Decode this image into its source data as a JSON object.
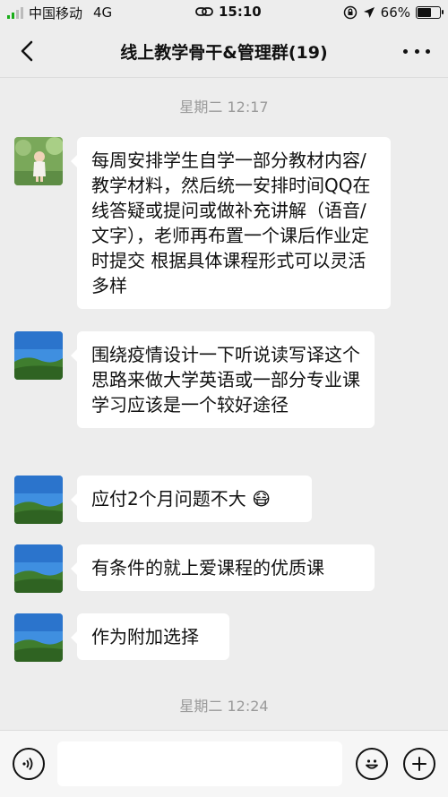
{
  "status_bar": {
    "carrier": "中国移动",
    "network": "4G",
    "time": "15:10",
    "battery": "66%",
    "battery_level": 0.66
  },
  "header": {
    "title": "线上教学骨干&管理群(19)"
  },
  "timestamps": [
    "星期二 12:17",
    "星期二 12:24"
  ],
  "messages": [
    {
      "text": "每周安排学生自学一部分教材内容/教学材料，然后统一安排时间QQ在线答疑或提问或做补充讲解（语音/文字），老师再布置一个课后作业定时提交 根据具体课程形式可以灵活多样"
    },
    {
      "text": "围绕疫情设计一下听说读写译这个思路来做大学英语或一部分专业课学习应该是一个较好途径"
    },
    {
      "text": "应付2个月问题不大",
      "emoji": "😷"
    },
    {
      "text": "有条件的就上爱课程的优质课"
    },
    {
      "text": "作为附加选择"
    }
  ],
  "colors": {
    "background": "#ededed",
    "bubble": "#ffffff",
    "signal_green": "#1aad19"
  },
  "icons": {
    "back": "chevron-left-icon",
    "more": "more-dots-icon",
    "voice": "voice-icon",
    "emoji": "emoji-icon",
    "plus": "plus-icon"
  }
}
